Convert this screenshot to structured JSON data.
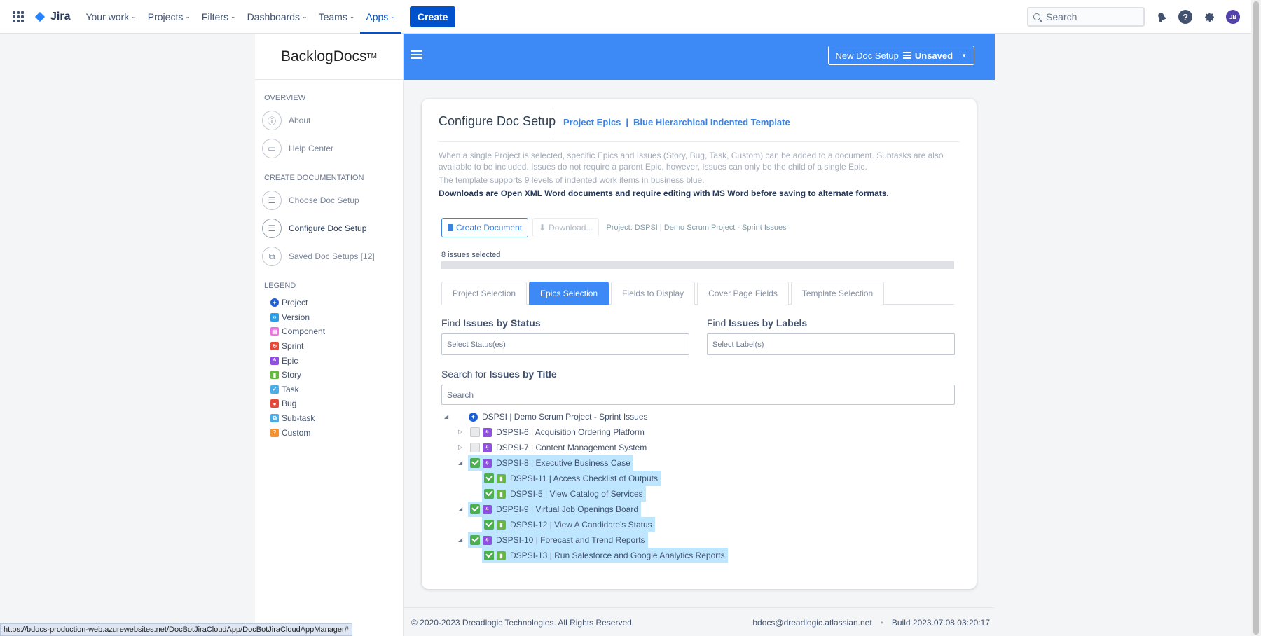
{
  "topnav": {
    "logo": "Jira",
    "items": [
      {
        "label": "Your work"
      },
      {
        "label": "Projects"
      },
      {
        "label": "Filters"
      },
      {
        "label": "Dashboards"
      },
      {
        "label": "Teams"
      },
      {
        "label": "Apps"
      }
    ],
    "active_item": "Apps",
    "create_label": "Create",
    "search_placeholder": "Search",
    "avatar_initials": "JB"
  },
  "sidebar": {
    "brand": "BacklogDocs",
    "brand_tm": "TM",
    "overview_heading": "OVERVIEW",
    "overview_items": [
      {
        "label": "About",
        "icon": "info-icon"
      },
      {
        "label": "Help Center",
        "icon": "chat-icon"
      }
    ],
    "create_heading": "CREATE DOCUMENTATION",
    "create_items": [
      {
        "label": "Choose Doc Setup",
        "icon": "list-icon"
      },
      {
        "label": "Configure Doc Setup",
        "icon": "list-icon"
      },
      {
        "label": "Saved Doc Setups [12]",
        "icon": "copy-icon"
      }
    ],
    "current_item": "Configure Doc Setup",
    "legend_heading": "LEGEND",
    "legend": [
      {
        "label": "Project",
        "color": "#1d5fd1"
      },
      {
        "label": "Version",
        "color": "#2d9ee5"
      },
      {
        "label": "Component",
        "color": "#e774e0"
      },
      {
        "label": "Sprint",
        "color": "#e5493a"
      },
      {
        "label": "Epic",
        "color": "#904ee2"
      },
      {
        "label": "Story",
        "color": "#63ba3c"
      },
      {
        "label": "Task",
        "color": "#4bade8"
      },
      {
        "label": "Bug",
        "color": "#e5493a"
      },
      {
        "label": "Sub-task",
        "color": "#4bade8"
      },
      {
        "label": "Custom",
        "color": "#f79232"
      }
    ]
  },
  "header": {
    "setup_label": "New Doc Setup",
    "setup_state": "Unsaved"
  },
  "card": {
    "title": "Configure Doc Setup",
    "subtitle_a": "Project Epics",
    "subtitle_sep": "|",
    "subtitle_b": "Blue Hierarchical Indented Template",
    "desc1": "When a single Project is selected, specific Epics and Issues (Story, Bug, Task, Custom) can be added to a document. Subtasks are also available to be included. Issues do not require a parent Epic, however, Issues can only be the child of a single Epic.",
    "desc2": "The template supports 9 levels of indented work items in business blue.",
    "desc3": "Downloads are Open XML Word documents and require editing with MS Word before saving to alternate formats.",
    "create_doc_label": "Create Document",
    "download_label": "Download...",
    "project_note": "Project: DSPSI | Demo Scrum Project - Sprint Issues",
    "issues_selected": "8 issues selected",
    "tabs": [
      {
        "label": "Project Selection"
      },
      {
        "label": "Epics Selection"
      },
      {
        "label": "Fields to Display"
      },
      {
        "label": "Cover Page Fields"
      },
      {
        "label": "Template Selection"
      }
    ],
    "active_tab": "Epics Selection",
    "status_label_a": "Find",
    "status_label_b": "Issues by Status",
    "status_placeholder": "Select Status(es)",
    "labels_label_a": "Find",
    "labels_label_b": "Issues by Labels",
    "labels_placeholder": "Select Label(s)",
    "title_search_label_a": "Search for",
    "title_search_label_b": "Issues by Title",
    "title_search_placeholder": "Search"
  },
  "tree": [
    {
      "label": "DSPSI | Demo Scrum Project - Sprint Issues",
      "type": "project",
      "level": 0,
      "state": "partial",
      "expand": "open",
      "selected": false
    },
    {
      "label": "DSPSI-6 | Acquisition Ordering Platform",
      "type": "epic",
      "level": 1,
      "state": "off",
      "expand": "closed",
      "selected": false
    },
    {
      "label": "DSPSI-7 | Content Management System",
      "type": "epic",
      "level": 1,
      "state": "off",
      "expand": "closed",
      "selected": false
    },
    {
      "label": "DSPSI-8 | Executive Business Case",
      "type": "epic",
      "level": 1,
      "state": "on",
      "expand": "open",
      "selected": true
    },
    {
      "label": "DSPSI-11 | Access Checklist of Outputs",
      "type": "story",
      "level": 2,
      "state": "on",
      "expand": "none",
      "selected": true
    },
    {
      "label": "DSPSI-5 | View Catalog of Services",
      "type": "story",
      "level": 2,
      "state": "on",
      "expand": "none",
      "selected": true
    },
    {
      "label": "DSPSI-9 | Virtual Job Openings Board",
      "type": "epic",
      "level": 1,
      "state": "on",
      "expand": "open",
      "selected": true
    },
    {
      "label": "DSPSI-12 | View A Candidate's Status",
      "type": "story",
      "level": 2,
      "state": "on",
      "expand": "none",
      "selected": true
    },
    {
      "label": "DSPSI-10 | Forecast and Trend Reports",
      "type": "epic",
      "level": 1,
      "state": "on",
      "expand": "open",
      "selected": true
    },
    {
      "label": "DSPSI-13 | Run Salesforce and Google Analytics Reports",
      "type": "story",
      "level": 2,
      "state": "on",
      "expand": "none",
      "selected": true
    }
  ],
  "footer": {
    "copyright": "© 2020-2023 Dreadlogic Technologies. All Rights Reserved.",
    "email": "bdocs@dreadlogic.atlassian.net",
    "build": "Build 2023.07.08.03:20:17"
  },
  "status_url": "https://bdocs-production-web.azurewebsites.net/DocBotJiraCloudApp/DocBotJiraCloudAppManager#"
}
